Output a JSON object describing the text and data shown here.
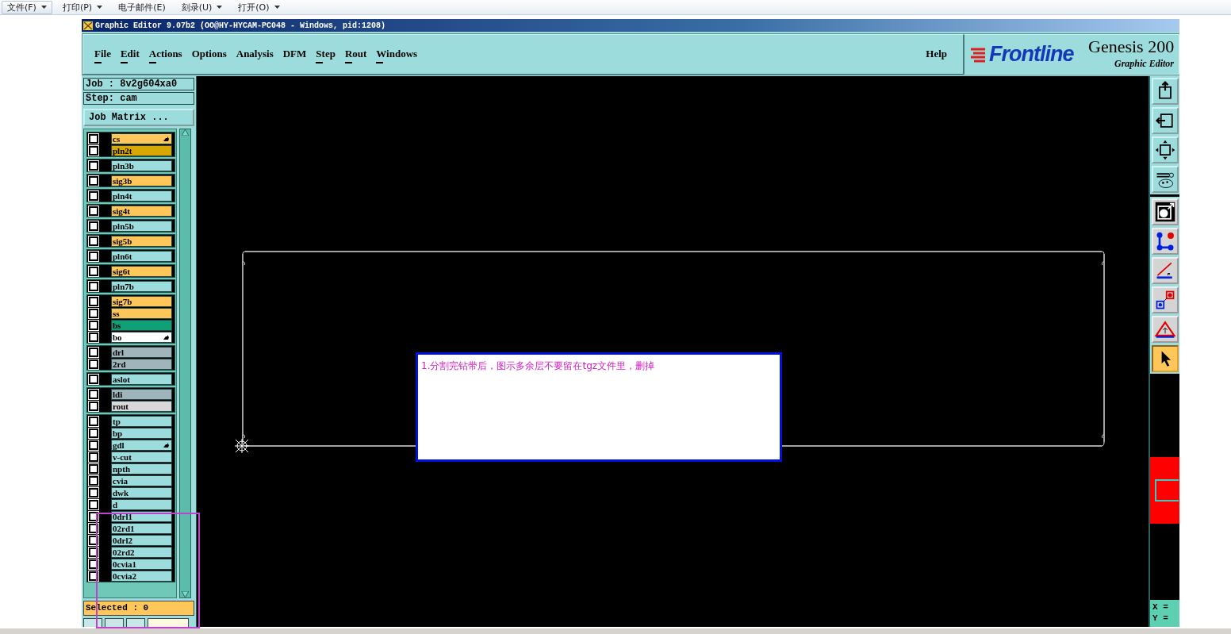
{
  "toolbar": [
    {
      "label": "文件(F)",
      "dropdown": true
    },
    {
      "label": "打印(P)",
      "dropdown": true
    },
    {
      "label": "电子邮件(E)",
      "dropdown": false
    },
    {
      "label": "刻录(U)",
      "dropdown": true
    },
    {
      "label": "打开(O)",
      "dropdown": true
    }
  ],
  "window": {
    "title": "Graphic Editor 9.07b2 (OO@HY-HYCAM-PC048 - Windows, pid:1208)"
  },
  "menu": [
    {
      "label": "File",
      "mnemonic": true
    },
    {
      "label": "Edit",
      "mnemonic": true
    },
    {
      "label": "Actions",
      "mnemonic": true
    },
    {
      "label": "Options",
      "mnemonic": false
    },
    {
      "label": "Analysis",
      "mnemonic": false
    },
    {
      "label": "DFM",
      "mnemonic": false
    },
    {
      "label": "Step",
      "mnemonic": true
    },
    {
      "label": "Rout",
      "mnemonic": true
    },
    {
      "label": "Windows",
      "mnemonic": true
    }
  ],
  "help": "Help",
  "logo": {
    "brand": "Frontline",
    "product": "Genesis 200",
    "subtitle": "Graphic Editor"
  },
  "job": "Job : 8v2g604xa0",
  "step": "Step: cam",
  "job_matrix": "Job Matrix ...",
  "layer_groups": [
    {
      "layers": [
        {
          "name": "cs",
          "color": "#ffc65a",
          "checked": false,
          "marked": true
        },
        {
          "name": "pln2t",
          "color": "#d8a800",
          "checked": false,
          "marked": false
        }
      ]
    },
    {
      "layers": [
        {
          "name": "pln3b",
          "color": "#9cdcdc",
          "checked": false,
          "marked": false
        }
      ]
    },
    {
      "layers": [
        {
          "name": "sig3b",
          "color": "#ffc65a",
          "checked": false,
          "marked": false
        }
      ]
    },
    {
      "layers": [
        {
          "name": "pln4t",
          "color": "#9cdcdc",
          "checked": false,
          "marked": false
        }
      ]
    },
    {
      "layers": [
        {
          "name": "sig4t",
          "color": "#ffc65a",
          "checked": false,
          "marked": false
        }
      ]
    },
    {
      "layers": [
        {
          "name": "pln5b",
          "color": "#9cdcdc",
          "checked": false,
          "marked": false
        }
      ]
    },
    {
      "layers": [
        {
          "name": "sig5b",
          "color": "#ffc65a",
          "checked": false,
          "marked": false
        }
      ]
    },
    {
      "layers": [
        {
          "name": "pln6t",
          "color": "#9cdcdc",
          "checked": false,
          "marked": false
        }
      ]
    },
    {
      "layers": [
        {
          "name": "sig6t",
          "color": "#ffc65a",
          "checked": false,
          "marked": false
        }
      ]
    },
    {
      "layers": [
        {
          "name": "pln7b",
          "color": "#9cdcdc",
          "checked": false,
          "marked": false
        }
      ]
    },
    {
      "layers": [
        {
          "name": "sig7b",
          "color": "#ffc65a",
          "checked": false,
          "marked": false
        },
        {
          "name": "ss",
          "color": "#ffc65a",
          "checked": false,
          "marked": false
        },
        {
          "name": "bs",
          "color": "#10a078",
          "checked": false,
          "marked": false
        },
        {
          "name": "bo",
          "color": "#ffffff",
          "checked": false,
          "marked": true
        }
      ]
    },
    {
      "layers": [
        {
          "name": "drl",
          "color": "#a0b4bc",
          "checked": false,
          "marked": false
        },
        {
          "name": "2rd",
          "color": "#a0b4bc",
          "checked": false,
          "marked": false
        }
      ]
    },
    {
      "layers": [
        {
          "name": "aslot",
          "color": "#9cdcdc",
          "checked": false,
          "marked": false
        }
      ]
    },
    {
      "layers": [
        {
          "name": "ldi",
          "color": "#a0b4bc",
          "checked": false,
          "marked": false
        },
        {
          "name": "rout",
          "color": "#d8d8d8",
          "checked": false,
          "marked": false
        }
      ]
    },
    {
      "layers": [
        {
          "name": "tp",
          "color": "#9cdcdc",
          "checked": false,
          "marked": false
        },
        {
          "name": "bp",
          "color": "#9cdcdc",
          "checked": false,
          "marked": false
        },
        {
          "name": "gdl",
          "color": "#9cdcdc",
          "checked": false,
          "marked": true
        },
        {
          "name": "v-cut",
          "color": "#9cdcdc",
          "checked": false,
          "marked": false
        },
        {
          "name": "npth",
          "color": "#9cdcdc",
          "checked": false,
          "marked": false
        },
        {
          "name": "cvia",
          "color": "#9cdcdc",
          "checked": false,
          "marked": false
        },
        {
          "name": "dwk",
          "color": "#9cdcdc",
          "checked": false,
          "marked": false
        },
        {
          "name": "d",
          "color": "#9cdcdc",
          "checked": false,
          "marked": false
        },
        {
          "name": "0drl1",
          "color": "#9cdcdc",
          "checked": false,
          "marked": false
        },
        {
          "name": "02rd1",
          "color": "#9cdcdc",
          "checked": false,
          "marked": false
        },
        {
          "name": "0drl2",
          "color": "#9cdcdc",
          "checked": false,
          "marked": false
        },
        {
          "name": "02rd2",
          "color": "#9cdcdc",
          "checked": false,
          "marked": false
        },
        {
          "name": "0cvia1",
          "color": "#9cdcdc",
          "checked": false,
          "marked": false
        },
        {
          "name": "0cvia2",
          "color": "#9cdcdc",
          "checked": false,
          "marked": false
        }
      ]
    }
  ],
  "selected_count": "Selected : 0",
  "canvas": {
    "note": "1.分割完钻带后，图示多余层不要留在tgz文件里，删掉"
  },
  "tools": [
    {
      "kind": "upload",
      "selected": false
    },
    {
      "kind": "import",
      "selected": false
    },
    {
      "kind": "fit",
      "selected": false
    },
    {
      "kind": "settings",
      "selected": false
    },
    {
      "kind": "shape",
      "selected": false
    },
    {
      "kind": "connect",
      "selected": false
    },
    {
      "kind": "angle",
      "selected": false
    },
    {
      "kind": "move",
      "selected": false
    },
    {
      "kind": "triangle",
      "selected": false
    },
    {
      "kind": "pointer",
      "selected": true
    }
  ],
  "coords": {
    "x": "X =",
    "y": "Y ="
  }
}
